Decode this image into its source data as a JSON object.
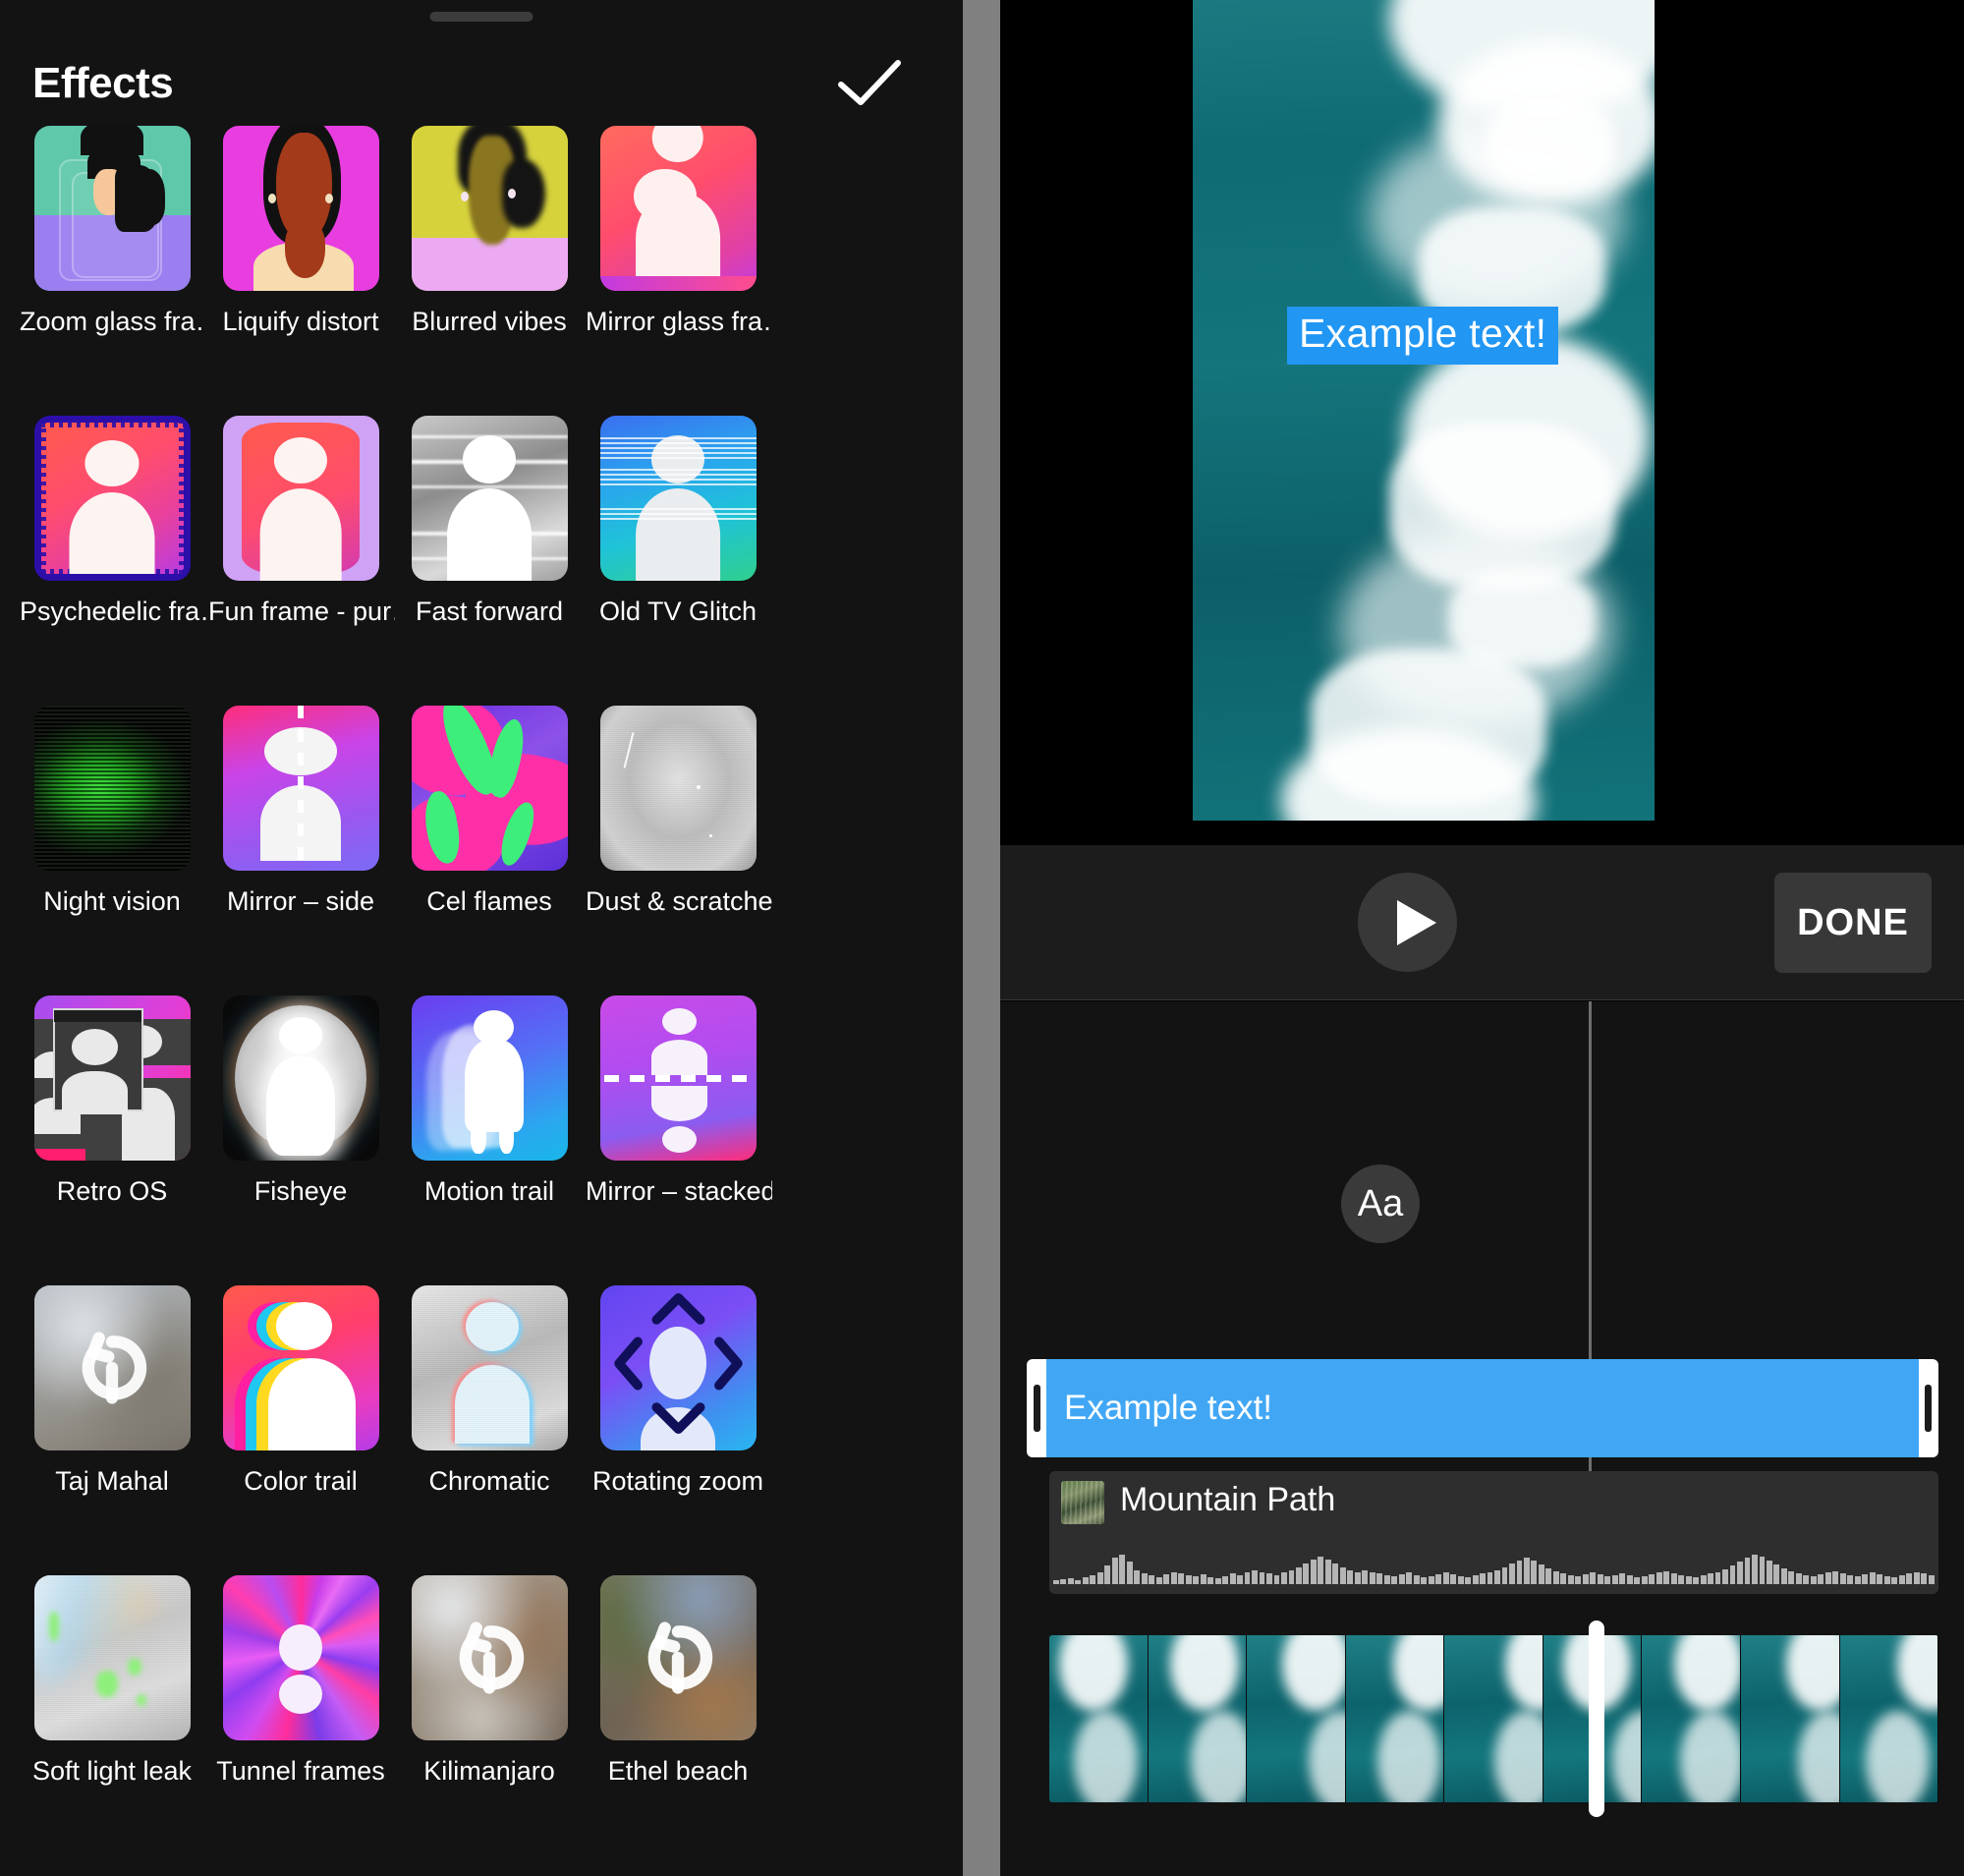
{
  "effects_panel": {
    "title": "Effects",
    "confirm_icon": "check-icon",
    "drag_handle": "drag-handle",
    "items": [
      {
        "label": "Zoom glass fra…",
        "style": "t-zoomglass"
      },
      {
        "label": "Liquify distort",
        "style": "t-liquify"
      },
      {
        "label": "Blurred vibes",
        "style": "t-blurred"
      },
      {
        "label": "Mirror glass fra…",
        "style": "t-mirrorglass"
      },
      {
        "label": "Psychedelic fra…",
        "style": "t-psych"
      },
      {
        "label": "Fun frame - pur…",
        "style": "t-funframe"
      },
      {
        "label": "Fast forward",
        "style": "t-fast"
      },
      {
        "label": "Old TV Glitch",
        "style": "t-oldtv"
      },
      {
        "label": "Night vision",
        "style": "t-night"
      },
      {
        "label": "Mirror – side",
        "style": "t-mside"
      },
      {
        "label": "Cel flames",
        "style": "t-cel"
      },
      {
        "label": "Dust & scratches",
        "style": "t-dust"
      },
      {
        "label": "Retro OS",
        "style": "t-retro"
      },
      {
        "label": "Fisheye",
        "style": "t-fish"
      },
      {
        "label": "Motion trail",
        "style": "t-motion"
      },
      {
        "label": "Mirror – stacked",
        "style": "t-mstack"
      },
      {
        "label": "Taj Mahal",
        "style": "t-taj"
      },
      {
        "label": "Color trail",
        "style": "t-ctrail"
      },
      {
        "label": "Chromatic",
        "style": "t-chrom"
      },
      {
        "label": "Rotating zoom",
        "style": "t-rotzoom"
      },
      {
        "label": "Soft light leak",
        "style": "t-softleak"
      },
      {
        "label": "Tunnel frames",
        "style": "t-tunnel"
      },
      {
        "label": "Kilimanjaro",
        "style": "t-kili"
      },
      {
        "label": "Ethel beach",
        "style": "t-ethel"
      }
    ]
  },
  "editor": {
    "preview": {
      "overlay_text": "Example text!",
      "overlay_color": "#2196f3"
    },
    "controls": {
      "play_icon": "play-icon",
      "done_label": "DONE"
    },
    "timeline": {
      "text_style_button": "Aa",
      "text_clip_label": "Example text!",
      "text_clip_color": "#41a7f5",
      "audio_clip_label": "Mountain Path",
      "audio_thumb": "album-art-thumbnail",
      "playhead": "playhead-indicator"
    }
  }
}
